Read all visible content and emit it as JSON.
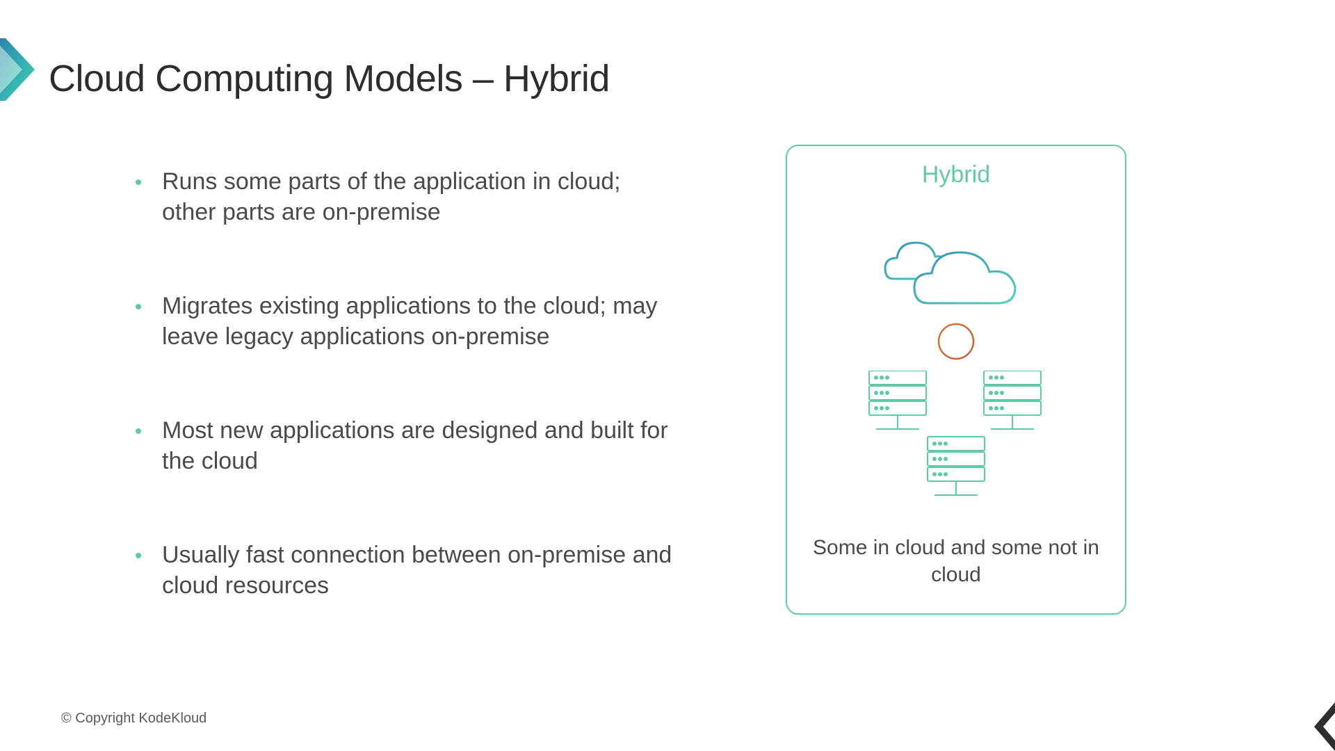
{
  "title": "Cloud Computing Models – Hybrid",
  "bullets": [
    "Runs some parts of the application in cloud; other parts are on-premise",
    "Migrates existing applications to the cloud; may leave legacy applications on-premise",
    "Most new applications are designed and built for the cloud",
    "Usually fast connection between on-premise and cloud resources"
  ],
  "card": {
    "title": "Hybrid",
    "caption": "Some in cloud and some not in cloud"
  },
  "copyright": "© Copyright KodeKloud"
}
